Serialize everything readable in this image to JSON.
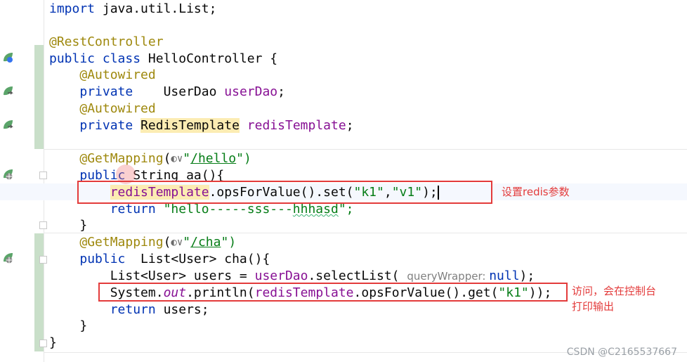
{
  "editor": {
    "lines": [
      [
        {
          "t": "import",
          "c": "kw"
        },
        {
          "t": " java.util.List;",
          "c": ""
        }
      ],
      [],
      [
        {
          "t": "@RestController",
          "c": "ann"
        }
      ],
      [
        {
          "t": "public class ",
          "c": "kw"
        },
        {
          "t": "HelloController {",
          "c": ""
        }
      ],
      [
        {
          "t": "    ",
          "c": ""
        },
        {
          "t": "@Autowired",
          "c": "ann"
        }
      ],
      [
        {
          "t": "    ",
          "c": ""
        },
        {
          "t": "private",
          "c": "kw"
        },
        {
          "t": "    UserDao ",
          "c": ""
        },
        {
          "t": "userDao",
          "c": "field"
        },
        {
          "t": ";",
          "c": ""
        }
      ],
      [
        {
          "t": "    ",
          "c": ""
        },
        {
          "t": "@Autowired",
          "c": "ann"
        }
      ],
      [
        {
          "t": "    ",
          "c": ""
        },
        {
          "t": "private ",
          "c": "kw"
        },
        {
          "t": "RedisTemplate",
          "c": "hl"
        },
        {
          "t": " ",
          "c": ""
        },
        {
          "t": "redisTemplate",
          "c": "field"
        },
        {
          "t": ";",
          "c": ""
        }
      ],
      [],
      [
        {
          "t": "    ",
          "c": ""
        },
        {
          "t": "@GetMapping",
          "c": "ann"
        },
        {
          "t": "(",
          "c": ""
        },
        {
          "t": "◐∨",
          "c": "globe"
        },
        {
          "t": "\"",
          "c": "str"
        },
        {
          "t": "/hello",
          "c": "strlink"
        },
        {
          "t": "\")",
          "c": "str"
        }
      ],
      [
        {
          "t": "    ",
          "c": ""
        },
        {
          "t": "public ",
          "c": "kw"
        },
        {
          "t": "String aa(){",
          "c": ""
        }
      ],
      [
        {
          "t": "        ",
          "c": ""
        },
        {
          "t": "redisTemplate",
          "c": "fieldhl"
        },
        {
          "t": ".opsForValue().set(",
          "c": ""
        },
        {
          "t": "\"k1\"",
          "c": "str"
        },
        {
          "t": ",",
          "c": ""
        },
        {
          "t": "\"v1\"",
          "c": "str"
        },
        {
          "t": ");",
          "c": ""
        },
        {
          "t": "",
          "c": "caret"
        }
      ],
      [
        {
          "t": "        ",
          "c": ""
        },
        {
          "t": "return ",
          "c": "kw"
        },
        {
          "t": "\"hello-----sss---",
          "c": "str"
        },
        {
          "t": "hhhasd",
          "c": "strunder"
        },
        {
          "t": "\";",
          "c": "str"
        }
      ],
      [
        {
          "t": "    }",
          "c": ""
        }
      ],
      [
        {
          "t": "    ",
          "c": ""
        },
        {
          "t": "@GetMapping",
          "c": "ann"
        },
        {
          "t": "(",
          "c": ""
        },
        {
          "t": "◐∨",
          "c": "globe"
        },
        {
          "t": "\"",
          "c": "str"
        },
        {
          "t": "/cha",
          "c": "strlink"
        },
        {
          "t": "\")",
          "c": "str"
        }
      ],
      [
        {
          "t": "    ",
          "c": ""
        },
        {
          "t": "public ",
          "c": "kw"
        },
        {
          "t": " List<User> cha(){",
          "c": ""
        }
      ],
      [
        {
          "t": "        List<User> users = ",
          "c": ""
        },
        {
          "t": "userDao",
          "c": "field"
        },
        {
          "t": ".selectList( ",
          "c": ""
        },
        {
          "t": "queryWrapper: ",
          "c": "hint"
        },
        {
          "t": "null",
          "c": "kw"
        },
        {
          "t": ");",
          "c": ""
        }
      ],
      [
        {
          "t": "        System.",
          "c": ""
        },
        {
          "t": "out",
          "c": "static"
        },
        {
          "t": ".println(",
          "c": ""
        },
        {
          "t": "redisTemplate",
          "c": "field"
        },
        {
          "t": ".opsForValue().get(",
          "c": ""
        },
        {
          "t": "\"k1\"",
          "c": "str"
        },
        {
          "t": "));",
          "c": ""
        }
      ],
      [
        {
          "t": "        ",
          "c": ""
        },
        {
          "t": "return ",
          "c": "kw"
        },
        {
          "t": "users;",
          "c": ""
        }
      ],
      [
        {
          "t": "    }",
          "c": ""
        }
      ],
      [
        {
          "t": "}",
          "c": ""
        }
      ]
    ]
  },
  "annotations": {
    "set_note": "设置redis参数",
    "get_note_line1": "访问，会在控制台",
    "get_note_line2": "打印输出"
  },
  "watermark": "CSDN @C2165537667",
  "colors": {
    "keyword": "#0033b3",
    "annotation": "#9e880d",
    "string": "#067d17",
    "field": "#871094",
    "red_box": "#e33b3b"
  },
  "gutter_icons": [
    "bean-icon",
    "bean-icon",
    "bean-icon",
    "globe-icon",
    "globe-icon"
  ]
}
